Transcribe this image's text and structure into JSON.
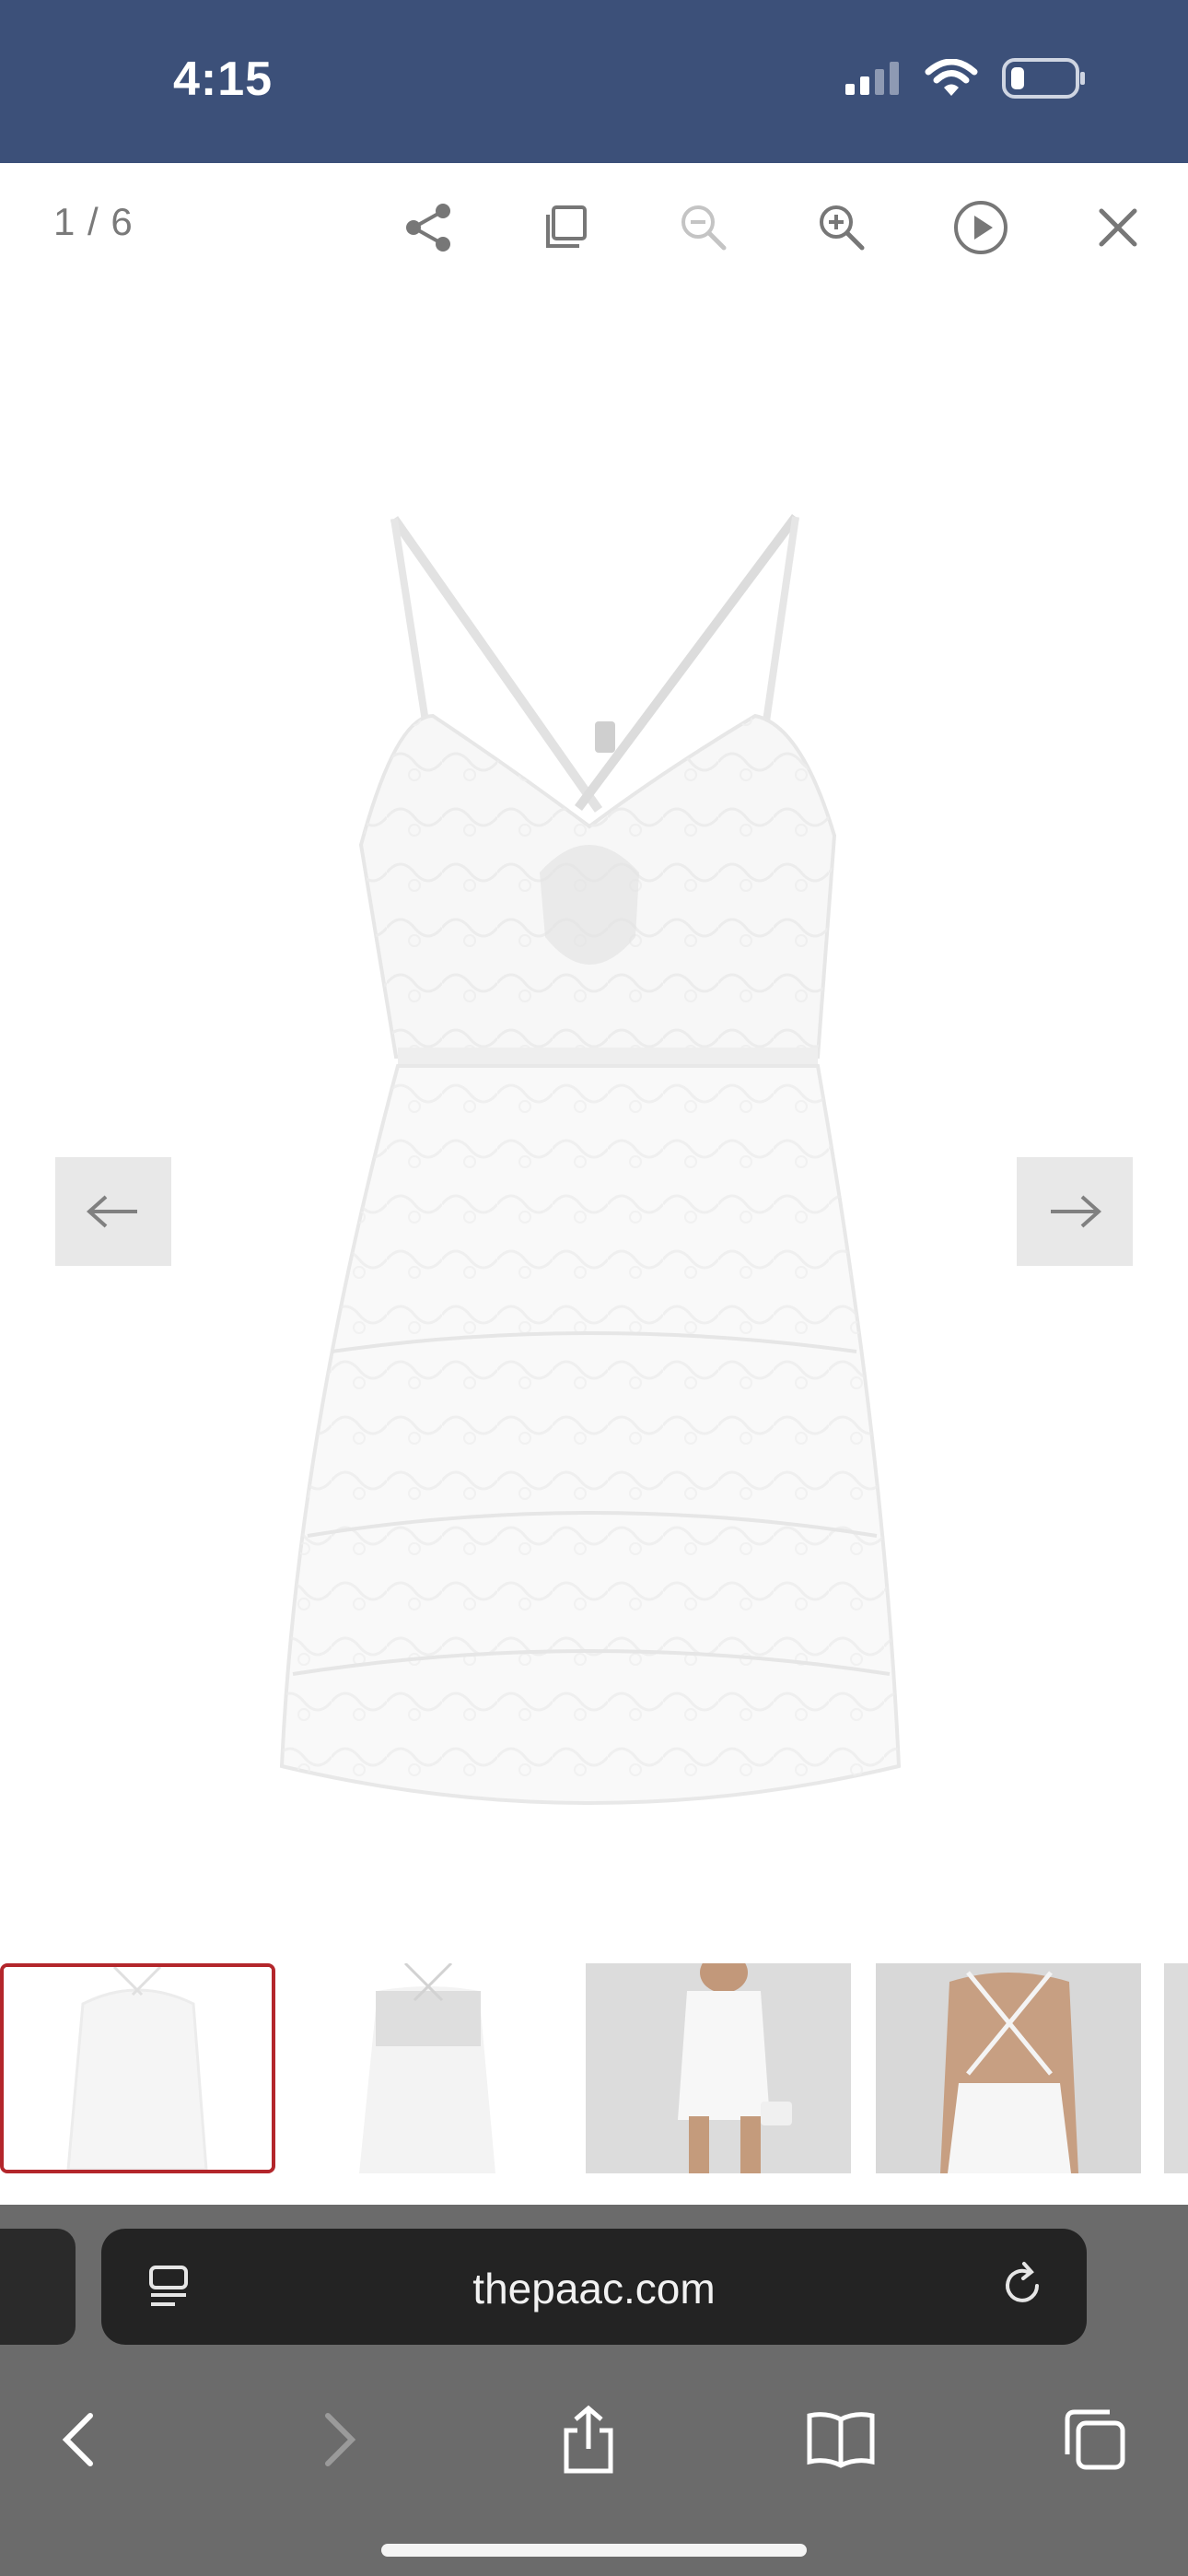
{
  "status_bar": {
    "time": "4:15",
    "icons": [
      "cellular-signal-icon",
      "wifi-icon",
      "battery-icon"
    ]
  },
  "lightbox": {
    "counter": "1 / 6",
    "toolbar_icons": [
      "share-icon",
      "copy-icon",
      "zoom-out-icon",
      "zoom-in-icon",
      "play-icon",
      "close-icon"
    ],
    "prev_icon": "arrow-left-icon",
    "next_icon": "arrow-right-icon",
    "thumbnails_count": 5,
    "active_thumbnail": 1
  },
  "browser": {
    "url": "thepaac.com",
    "reader_icon": "page-menu-icon",
    "reload_icon": "reload-icon",
    "toolbar_icons": [
      "back-icon",
      "forward-icon",
      "share-icon",
      "bookmarks-icon",
      "tabs-icon"
    ]
  },
  "colors": {
    "status_bar_bg": "#3c5079",
    "active_thumb_border": "#b3262b",
    "safari_bg": "#6b6b6b",
    "urlbar_bg": "#232323"
  }
}
